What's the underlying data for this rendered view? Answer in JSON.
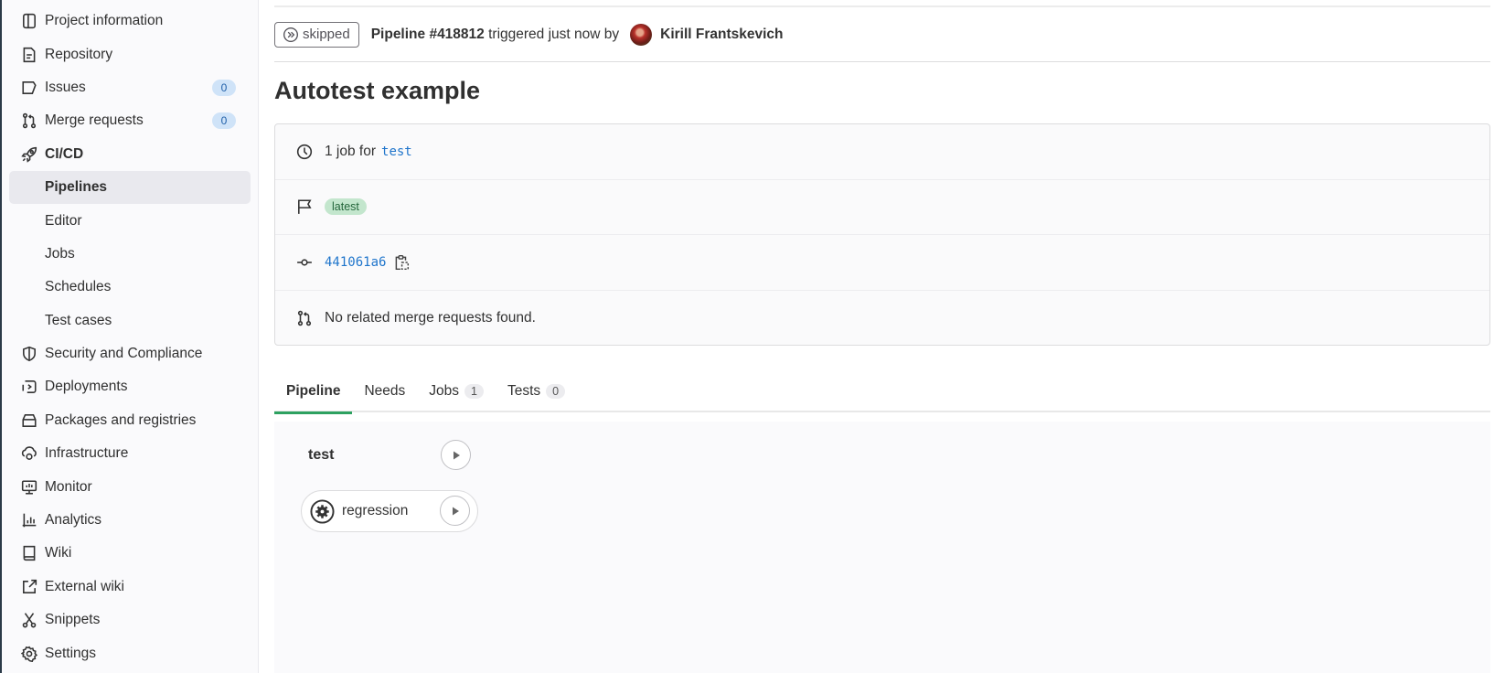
{
  "sidebar": {
    "items": [
      {
        "label": "Project information",
        "icon": "project-info-icon"
      },
      {
        "label": "Repository",
        "icon": "document-icon"
      },
      {
        "label": "Issues",
        "icon": "issues-icon",
        "count": "0"
      },
      {
        "label": "Merge requests",
        "icon": "merge-request-icon",
        "count": "0"
      },
      {
        "label": "CI/CD",
        "icon": "rocket-icon",
        "active_section": true
      },
      {
        "label": "Security and Compliance",
        "icon": "shield-icon"
      },
      {
        "label": "Deployments",
        "icon": "deployments-icon"
      },
      {
        "label": "Packages and registries",
        "icon": "package-icon"
      },
      {
        "label": "Infrastructure",
        "icon": "cloud-gear-icon"
      },
      {
        "label": "Monitor",
        "icon": "monitor-icon"
      },
      {
        "label": "Analytics",
        "icon": "analytics-icon"
      },
      {
        "label": "Wiki",
        "icon": "book-icon"
      },
      {
        "label": "External wiki",
        "icon": "external-link-icon"
      },
      {
        "label": "Snippets",
        "icon": "scissors-icon"
      },
      {
        "label": "Settings",
        "icon": "gear-icon"
      }
    ],
    "cicd_subitems": [
      {
        "label": "Pipelines",
        "active": true
      },
      {
        "label": "Editor"
      },
      {
        "label": "Jobs"
      },
      {
        "label": "Schedules"
      },
      {
        "label": "Test cases"
      }
    ]
  },
  "header": {
    "status": "skipped",
    "pipeline_label": "Pipeline #418812",
    "triggered_text": " triggered just now by",
    "author": "Kirill Frantskevich"
  },
  "page_title": "Autotest example",
  "info": {
    "jobs_text": "1 job for",
    "ref": "test",
    "badge": "latest",
    "commit_sha": "441061a6",
    "merge_requests_text": "No related merge requests found."
  },
  "tabs": [
    {
      "label": "Pipeline",
      "active": true
    },
    {
      "label": "Needs"
    },
    {
      "label": "Jobs",
      "count": "1"
    },
    {
      "label": "Tests",
      "count": "0"
    }
  ],
  "graph": {
    "stage": "test",
    "jobs": [
      {
        "name": "regression",
        "status": "manual"
      }
    ]
  },
  "colors": {
    "accent_tab": "#2da160",
    "link": "#1f75cb",
    "latest_badge_bg": "#c3e6cd",
    "count_badge_bg": "#cfe3f8"
  }
}
